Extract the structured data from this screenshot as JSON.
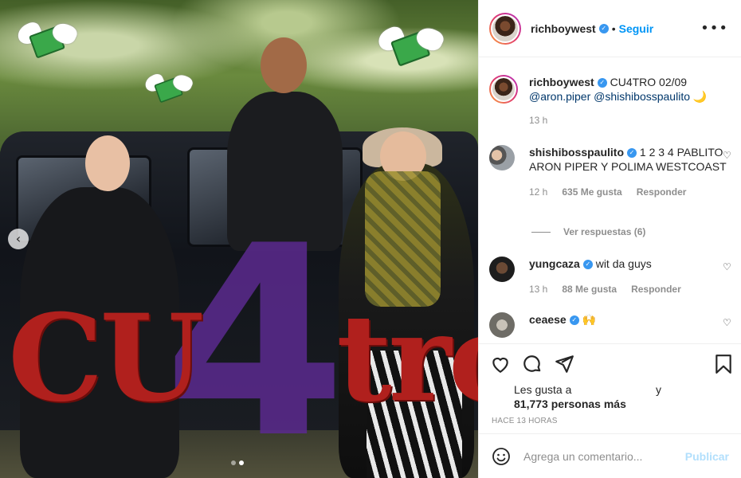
{
  "post": {
    "image_alt": "CU4TRO",
    "graffiti_left": "CU",
    "graffiti_four": "4",
    "graffiti_right": "tro",
    "carousel_prev": "‹",
    "carousel_count": 2,
    "carousel_active": 2
  },
  "header": {
    "username": "richboywest",
    "separator": "•",
    "follow_label": "Seguir",
    "more_label": "•••"
  },
  "caption": {
    "username": "richboywest",
    "text": "CU4TRO 02/09",
    "mention1": "@aron.piper",
    "mention2": "@shishibosspaulito",
    "emoji": "🌙",
    "time": "13 h"
  },
  "comments": [
    {
      "username": "shishibosspaulito",
      "text": "1 2 3 4 PABLITO ARON PIPER Y POLIMA WESTCOAST",
      "time": "12 h",
      "likes": "635 Me gusta",
      "reply": "Responder",
      "view_replies": "Ver respuestas (6)"
    },
    {
      "username": "yungcaza",
      "text": "wit da guys",
      "time": "13 h",
      "likes": "88 Me gusta",
      "reply": "Responder"
    },
    {
      "username": "ceaese",
      "text": "🙌"
    }
  ],
  "likes": {
    "line1": "Les gusta a",
    "and": "y",
    "line2_count": "81,773",
    "line2_rest": "personas más"
  },
  "time_ago": "HACE 13 HORAS",
  "add_comment": {
    "placeholder": "Agrega un comentario...",
    "publish_label": "Publicar"
  },
  "icons": {
    "like": "heart-icon",
    "comment": "comment-icon",
    "share": "share-icon",
    "save": "bookmark-icon",
    "emoji": "smiley-icon"
  },
  "colors": {
    "accent": "#0095f6",
    "verified": "#3897f0",
    "muted": "#8e8e8e",
    "publish_disabled": "#b2dffc"
  }
}
